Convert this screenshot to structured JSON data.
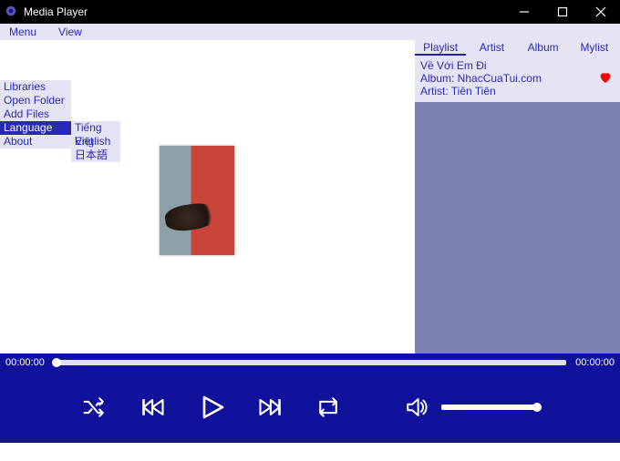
{
  "window": {
    "title": "Media Player"
  },
  "menubar": {
    "menu": "Menu",
    "view": "View"
  },
  "dropdown": {
    "libraries": "Libraries",
    "open_folder": "Open Folder",
    "add_files": "Add Files",
    "language": "Language",
    "about": "About"
  },
  "language_submenu": {
    "vi": "Tiếng Việt",
    "en": "English",
    "ja": "日本語"
  },
  "side": {
    "tabs": {
      "playlist": "Playlist",
      "artist": "Artist",
      "album": "Album",
      "mylist": "Mylist"
    },
    "track": {
      "title": "Về Với Em Đi",
      "album_line": "Album: NhacCuaTui.com",
      "artist_line": "Artist: Tiên Tiên"
    }
  },
  "progress": {
    "elapsed": "00:00:00",
    "total": "00:00:00"
  },
  "colors": {
    "accent": "#2828b8",
    "dark": "#10129c",
    "panel": "#e4e4f4",
    "sidebody": "#7a82b4",
    "heart": "#ff0000"
  }
}
